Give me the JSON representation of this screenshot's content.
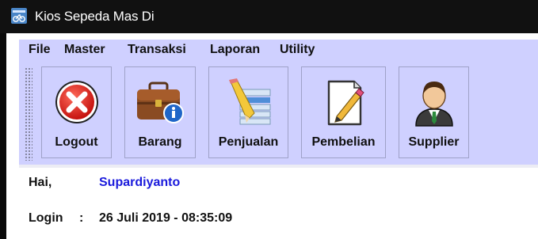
{
  "window": {
    "title": "Kios Sepeda Mas Di",
    "icon": "app-window-icon"
  },
  "menu": [
    {
      "label": "File"
    },
    {
      "label": "Master"
    },
    {
      "label": "Transaksi"
    },
    {
      "label": "Laporan"
    },
    {
      "label": "Utility"
    }
  ],
  "toolbar": [
    {
      "label": "Logout",
      "icon": "logout-icon"
    },
    {
      "label": "Barang",
      "icon": "briefcase-info-icon"
    },
    {
      "label": "Penjualan",
      "icon": "sales-edit-icon"
    },
    {
      "label": "Pembelian",
      "icon": "document-pencil-icon"
    },
    {
      "label": "Supplier",
      "icon": "supplier-person-icon"
    }
  ],
  "greeting": {
    "label": "Hai,",
    "name": "Supardiyanto"
  },
  "login": {
    "label": "Login",
    "colon": ":",
    "value": "26 Juli 2019 - 08:35:09"
  },
  "colors": {
    "menu_bg": "#cfd0ff",
    "username": "#1a1adc",
    "titlebar": "#111111"
  }
}
